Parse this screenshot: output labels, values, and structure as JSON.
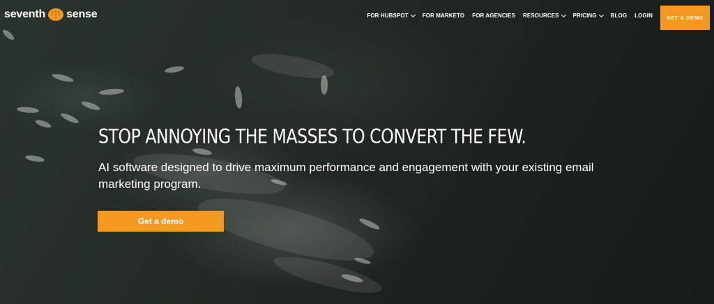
{
  "logo": {
    "left_text": "seventh",
    "right_text": "sense",
    "icon": "brain-icon"
  },
  "nav": {
    "items": [
      {
        "label": "FOR HUBSPOT",
        "dropdown": true
      },
      {
        "label": "FOR MARKETO",
        "dropdown": false
      },
      {
        "label": "FOR AGENCIES",
        "dropdown": false
      },
      {
        "label": "RESOURCES",
        "dropdown": true
      },
      {
        "label": "PRICING",
        "dropdown": true
      },
      {
        "label": "BLOG",
        "dropdown": false
      },
      {
        "label": "LOGIN",
        "dropdown": false
      }
    ],
    "cta_label": "GET A DEMO"
  },
  "hero": {
    "headline": "STOP ANNOYING THE MASSES TO CONVERT THE FEW.",
    "subhead": "AI software designed to drive maximum performance and engagement with your existing email marketing program.",
    "cta_label": "Get a demo"
  },
  "colors": {
    "accent": "#f49a23",
    "text": "#ffffff",
    "background": "#1d2420"
  }
}
